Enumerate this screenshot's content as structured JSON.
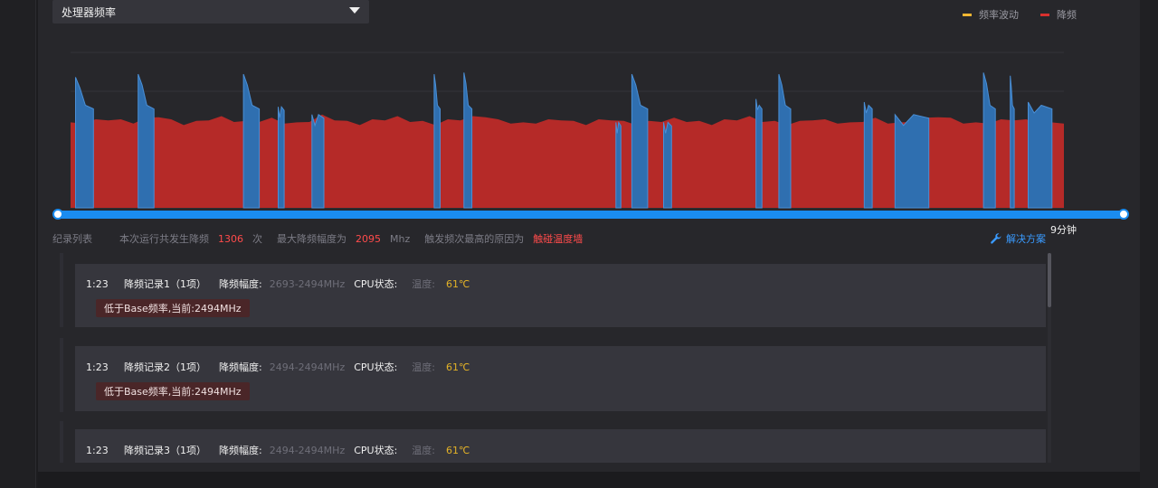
{
  "header": {
    "dropdown_label": "处理器频率",
    "legend": [
      {
        "label": "频率波动",
        "color": "#f2b632"
      },
      {
        "label": "降频",
        "color": "#d8302e"
      }
    ]
  },
  "timeline": {
    "end_label": "9分钟",
    "scrubber": {
      "start": 0.0,
      "end": 1.0
    }
  },
  "summary": {
    "list_title": "纪录列表",
    "count_prefix": "本次运行共发生降频",
    "count_value": "1306",
    "count_unit": "次",
    "max_prefix": "最大降频幅度为",
    "max_value": "2095",
    "max_unit": "Mhz",
    "cause_prefix": "触发频次最高的原因为",
    "cause_value": "触碰温度墙",
    "fix_label": "解决方案"
  },
  "records": [
    {
      "time": "1:23",
      "name": "降频记录1（1项）",
      "range_label": "降频幅度:",
      "range": "2693-2494MHz",
      "cpu_label": "CPU状态:",
      "temp_label": "温度:",
      "temp": "61℃",
      "tag": "低于Base频率,当前:2494MHz"
    },
    {
      "time": "1:23",
      "name": "降频记录2（1项）",
      "range_label": "降频幅度:",
      "range": "2494-2494MHz",
      "cpu_label": "CPU状态:",
      "temp_label": "温度:",
      "temp": "61℃",
      "tag": "低于Base频率,当前:2494MHz"
    },
    {
      "time": "1:23",
      "name": "降频记录3（1项）",
      "range_label": "降频幅度:",
      "range": "2494-2494MHz",
      "cpu_label": "CPU状态:",
      "temp_label": "温度:",
      "temp": "61℃",
      "tag": ""
    }
  ],
  "colors": {
    "throttle": "#b52a28",
    "fluctuation": "#2f6fb0",
    "accent": "#1a8cf0"
  },
  "chart_data": {
    "type": "area",
    "series": [
      {
        "name": "降频",
        "color": "#b52a28",
        "values": [
          0.55,
          0.56,
          0.57,
          0.58,
          0.57,
          0.56,
          0.58,
          0.6,
          0.57,
          0.55,
          0.56,
          0.58,
          0.59,
          0.57,
          0.56,
          0.57,
          0.58,
          0.56,
          0.55,
          0.57,
          0.6,
          0.58,
          0.56,
          0.55,
          0.57,
          0.58,
          0.59,
          0.57,
          0.56,
          0.55,
          0.57,
          0.58,
          0.59,
          0.6,
          0.57,
          0.56,
          0.55,
          0.56,
          0.57,
          0.58,
          0.56,
          0.55,
          0.57,
          0.58,
          0.56,
          0.55,
          0.56,
          0.57,
          0.58,
          0.57,
          0.56,
          0.55,
          0.57,
          0.58,
          0.59,
          0.57,
          0.56,
          0.55,
          0.56,
          0.58,
          0.57,
          0.56,
          0.55,
          0.57,
          0.58,
          0.56,
          0.55,
          0.57,
          0.58,
          0.6,
          0.58,
          0.56,
          0.55,
          0.56,
          0.57,
          0.58,
          0.57,
          0.56,
          0.55,
          0.56
        ]
      },
      {
        "name": "频率波动",
        "color": "#2f6fb0",
        "spikes": [
          {
            "at": 0.005,
            "width": 0.018,
            "peak": 0.84
          },
          {
            "at": 0.068,
            "width": 0.016,
            "peak": 0.86
          },
          {
            "at": 0.174,
            "width": 0.016,
            "peak": 0.86
          },
          {
            "at": 0.209,
            "width": 0.006,
            "peak": 0.65
          },
          {
            "at": 0.243,
            "width": 0.012,
            "peak": 0.6
          },
          {
            "at": 0.366,
            "width": 0.006,
            "peak": 0.86
          },
          {
            "at": 0.396,
            "width": 0.008,
            "peak": 0.87
          },
          {
            "at": 0.549,
            "width": 0.005,
            "peak": 0.55
          },
          {
            "at": 0.565,
            "width": 0.016,
            "peak": 0.86
          },
          {
            "at": 0.597,
            "width": 0.008,
            "peak": 0.55
          },
          {
            "at": 0.69,
            "width": 0.006,
            "peak": 0.7
          },
          {
            "at": 0.713,
            "width": 0.012,
            "peak": 0.86
          },
          {
            "at": 0.799,
            "width": 0.008,
            "peak": 0.68
          },
          {
            "at": 0.83,
            "width": 0.034,
            "peak": 0.6
          },
          {
            "at": 0.919,
            "width": 0.012,
            "peak": 0.87
          },
          {
            "at": 0.946,
            "width": 0.004,
            "peak": 0.85
          },
          {
            "at": 0.964,
            "width": 0.024,
            "peak": 0.68
          }
        ]
      }
    ],
    "ylim": [
      0,
      1
    ],
    "grid": true
  }
}
